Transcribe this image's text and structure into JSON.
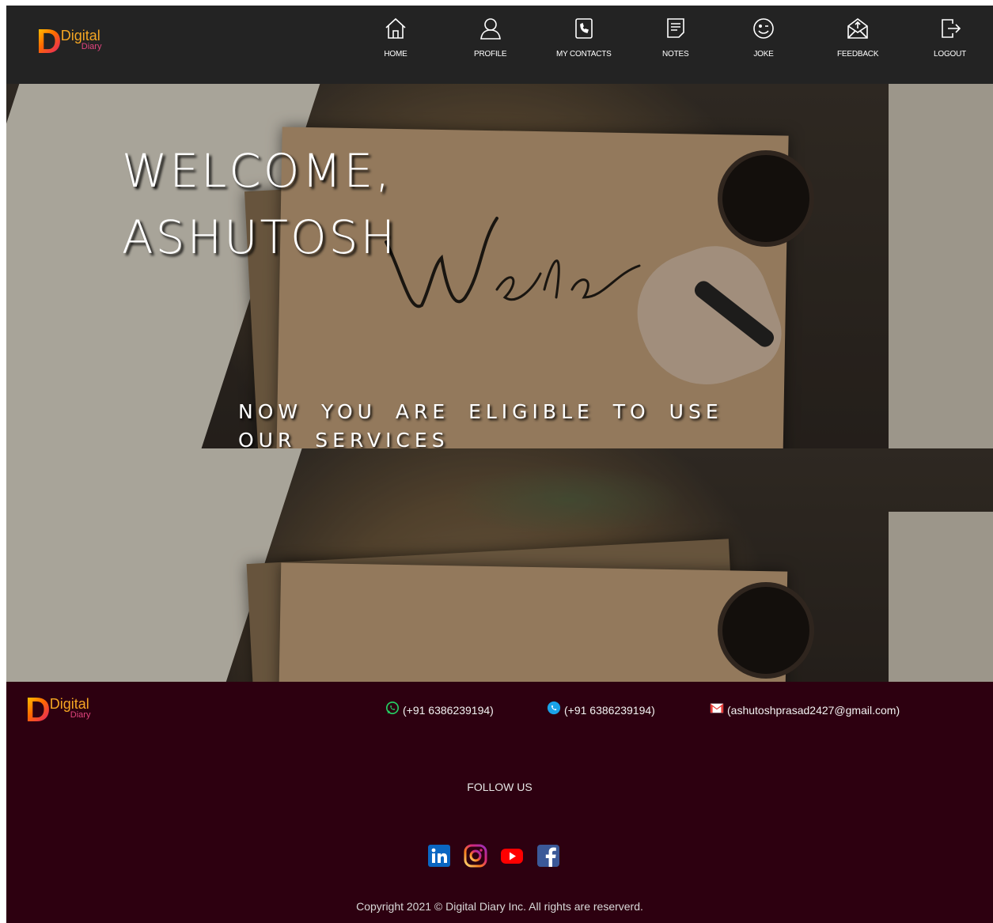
{
  "brand": {
    "word1": "Digital",
    "word2": "Diary",
    "mark": "D"
  },
  "nav": {
    "items": [
      {
        "label": "HOME",
        "icon": "home-icon"
      },
      {
        "label": "PROFILE",
        "icon": "user-icon"
      },
      {
        "label": "MY CONTACTS",
        "icon": "phone-book-icon"
      },
      {
        "label": "NOTES",
        "icon": "note-icon"
      },
      {
        "label": "JOKE",
        "icon": "smile-icon"
      },
      {
        "label": "FEEDBACK",
        "icon": "mail-open-icon"
      },
      {
        "label": "LOGOUT",
        "icon": "logout-icon"
      }
    ]
  },
  "hero": {
    "title_line1": "WELCOME,",
    "title_line2": "ASHUTOSH",
    "subtitle": "NOW YOU ARE ELIGIBLE TO USE OUR SERVICES",
    "background_script": "Welcome"
  },
  "footer": {
    "contacts": [
      {
        "icon": "whatsapp-icon",
        "text": "(+91 6386239194)",
        "color": "#25d366"
      },
      {
        "icon": "skype-icon",
        "text": "(+91 6386239194)",
        "color": "#1aa3e8"
      },
      {
        "icon": "gmail-icon",
        "text": "(ashutoshprasad2427@gmail.com)",
        "color": "#e53935"
      }
    ],
    "follow_us": "FOLLOW US",
    "social": [
      "linkedin-icon",
      "instagram-icon",
      "youtube-icon",
      "facebook-icon"
    ],
    "copyright": "Copyright 2021 © Digital Diary Inc. All rights are reserverd."
  },
  "colors": {
    "nav_bg": "#232323",
    "footer_bg": "#2d0010",
    "logo_gradient": [
      "#ffd400",
      "#ff6a00",
      "#e1137a"
    ]
  }
}
